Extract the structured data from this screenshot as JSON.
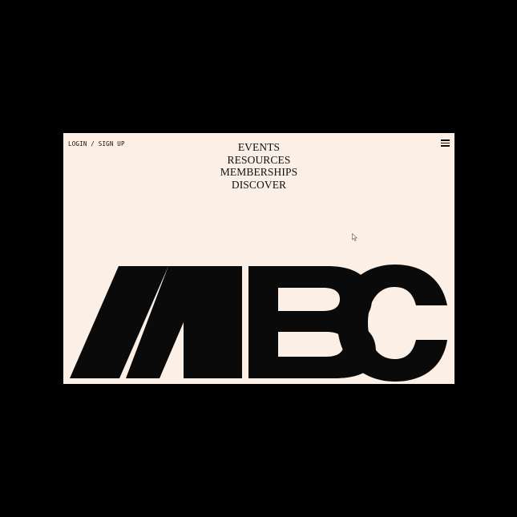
{
  "header": {
    "auth_label": "LOGIN / SIGN UP"
  },
  "nav": {
    "items": [
      {
        "label": "EVENTS"
      },
      {
        "label": "RESOURCES"
      },
      {
        "label": "MEMBERSHIPS"
      },
      {
        "label": "DISCOVER"
      }
    ]
  },
  "logo": {
    "text": "MBC",
    "color": "#0a0a0a"
  },
  "icons": {
    "menu": "hamburger-menu-icon",
    "cursor": "mouse-pointer-icon"
  },
  "colors": {
    "background": "#000000",
    "page": "#fbefe6",
    "text": "#111111"
  }
}
